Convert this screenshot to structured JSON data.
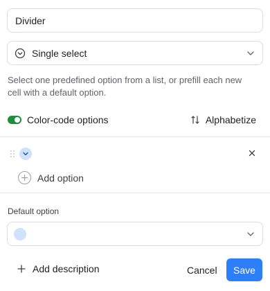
{
  "field_name": {
    "value": "Divider"
  },
  "field_type": {
    "icon": "chevron-circle-icon",
    "label": "Single select"
  },
  "description": "Select one predefined option from a list, or prefill each new cell with a default option.",
  "color_code": {
    "label": "Color-code options",
    "enabled": true,
    "color": "#1e8e3e"
  },
  "alphabetize": {
    "label": "Alphabetize",
    "icon": "sort-icon"
  },
  "options": [
    {
      "label": "",
      "color": "#cfe1fb"
    }
  ],
  "add_option": {
    "label": "Add option"
  },
  "default_option": {
    "label": "Default option",
    "value": "",
    "color": "#cfe1fb"
  },
  "footer": {
    "add_description": "Add description",
    "cancel": "Cancel",
    "save": "Save",
    "save_color": "#2d7ff9"
  }
}
